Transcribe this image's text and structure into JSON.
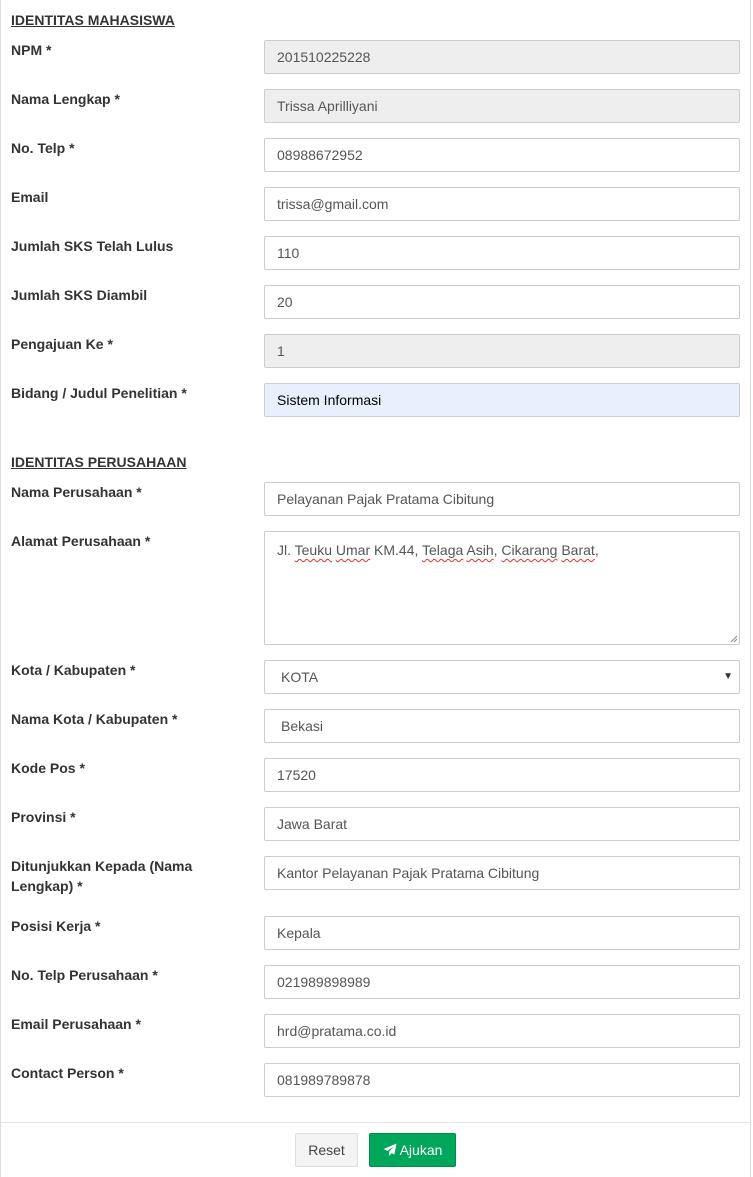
{
  "mahasiswa": {
    "title": "IDENTITAS MAHASISWA",
    "fields": [
      {
        "label": "NPM *",
        "value": "201510225228"
      },
      {
        "label": "Nama Lengkap *",
        "value": "Trissa Aprilliyani"
      },
      {
        "label": "No. Telp *",
        "value": "08988672952"
      },
      {
        "label": "Email",
        "value": "trissa@gmail.com"
      },
      {
        "label": "Jumlah SKS Telah Lulus",
        "value": "110"
      },
      {
        "label": "Jumlah SKS Diambil",
        "value": "20"
      },
      {
        "label": "Pengajuan Ke *",
        "value": "1"
      },
      {
        "label": "Bidang / Judul Penelitian *",
        "value": "Sistem Informasi"
      }
    ]
  },
  "perusahaan": {
    "title": "IDENTITAS PERUSAHAAN",
    "nama": {
      "label": "Nama Perusahaan *",
      "value": "Pelayanan Pajak Pratama Cibitung"
    },
    "alamat": {
      "label": "Alamat Perusahaan *",
      "value": "Jl. Teuku Umar KM.44, Telaga Asih, Cikarang Barat,"
    },
    "kota_type": {
      "label": "Kota / Kabupaten *",
      "value": "KOTA"
    },
    "kota_nama": {
      "label": "Nama Kota / Kabupaten *",
      "value": "Bekasi"
    },
    "kode_pos": {
      "label": "Kode Pos *",
      "value": "17520"
    },
    "provinsi": {
      "label": "Provinsi *",
      "value": "Jawa Barat"
    },
    "ditujukan": {
      "label": "Ditunjukkan Kepada (Nama Lengkap) *",
      "value": "Kantor Pelayanan Pajak Pratama Cibitung"
    },
    "posisi": {
      "label": "Posisi Kerja *",
      "value": "Kepala"
    },
    "telp": {
      "label": "No. Telp Perusahaan *",
      "value": "021989898989"
    },
    "email": {
      "label": "Email Perusahaan *",
      "value": "hrd@pratama.co.id"
    },
    "contact": {
      "label": "Contact Person *",
      "value": "081989789878"
    }
  },
  "actions": {
    "reset_label": "Reset",
    "submit_label": "Ajukan"
  },
  "colors": {
    "submit": "#00a65a",
    "readonly_bg": "#eeeeee",
    "autofill_bg": "#e8f0fe"
  },
  "icons": {
    "submit": "paper-plane-icon",
    "select": "caret-down-icon"
  }
}
